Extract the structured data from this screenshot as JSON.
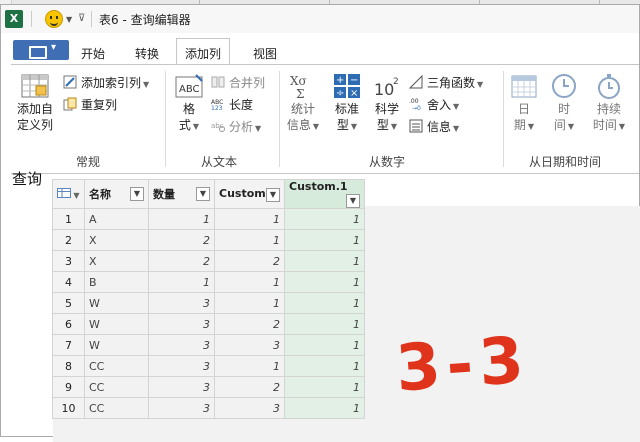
{
  "window": {
    "title": "表6 - 查询编辑器"
  },
  "ribbon": {
    "tabs": [
      {
        "label": "开始"
      },
      {
        "label": "转换"
      },
      {
        "label": "添加列",
        "active": true
      },
      {
        "label": "视图"
      }
    ],
    "groups": {
      "general": {
        "label": "常规",
        "add_custom_column": "添加自\n定义列",
        "add_index_column": "添加索引列",
        "duplicate_column": "重复列"
      },
      "from_text": {
        "label": "从文本",
        "format": "格\n式",
        "merge_columns": "合并列",
        "length": "长度",
        "analyze": "分析"
      },
      "from_number": {
        "label": "从数字",
        "statistics": "统计\n信息",
        "standard": "标准\n型",
        "scientific": "科学\n型",
        "trigonometry": "三角函数",
        "rounding": "舍入",
        "information": "信息"
      },
      "from_datetime": {
        "label": "从日期和时间",
        "date": "日\n期",
        "time": "时\n间",
        "duration": "持续\n时间"
      }
    }
  },
  "query_label": "查询",
  "table": {
    "columns": [
      "名称",
      "数量",
      "Custom",
      "Custom.1"
    ],
    "rows": [
      [
        "1",
        "A",
        "1",
        "1",
        "1"
      ],
      [
        "2",
        "X",
        "2",
        "1",
        "1"
      ],
      [
        "3",
        "X",
        "2",
        "2",
        "1"
      ],
      [
        "4",
        "B",
        "1",
        "1",
        "1"
      ],
      [
        "5",
        "W",
        "3",
        "1",
        "1"
      ],
      [
        "6",
        "W",
        "3",
        "2",
        "1"
      ],
      [
        "7",
        "W",
        "3",
        "3",
        "1"
      ],
      [
        "8",
        "CC",
        "3",
        "1",
        "1"
      ],
      [
        "9",
        "CC",
        "3",
        "2",
        "1"
      ],
      [
        "10",
        "CC",
        "3",
        "3",
        "1"
      ]
    ]
  },
  "annotation": "3-3",
  "colors": {
    "accent_green": "#e2f0e6",
    "file_button": "#3f6eb4",
    "annotation_red": "#e0331c"
  }
}
